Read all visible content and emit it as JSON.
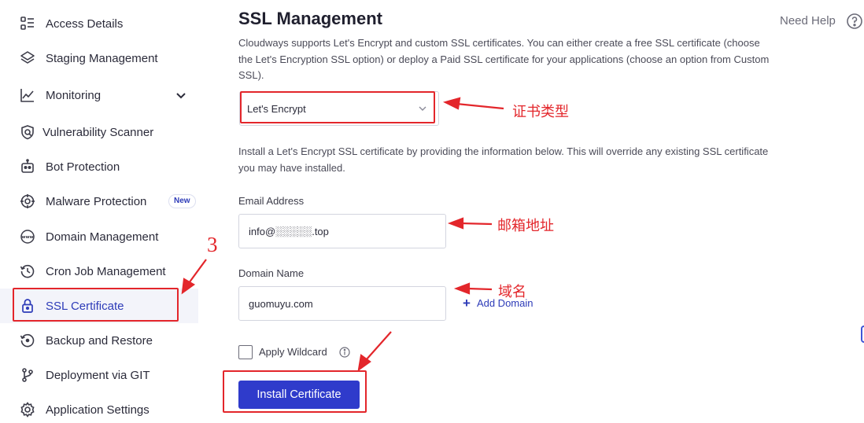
{
  "sidebar": {
    "items": [
      {
        "label": "Access Details",
        "icon": "access-details-icon"
      },
      {
        "label": "Staging Management",
        "icon": "layers-icon"
      },
      {
        "label": "Monitoring",
        "icon": "line-chart-icon"
      },
      {
        "label": "Vulnerability Scanner",
        "icon": "shield-scan-icon"
      },
      {
        "label": "Bot Protection",
        "icon": "robot-icon"
      },
      {
        "label": "Malware Protection",
        "icon": "target-icon",
        "badge": "New"
      },
      {
        "label": "Domain Management",
        "icon": "www-globe-icon"
      },
      {
        "label": "Cron Job Management",
        "icon": "history-clock-icon"
      },
      {
        "label": "SSL Certificate",
        "icon": "lock-icon",
        "active": true
      },
      {
        "label": "Backup and Restore",
        "icon": "restore-icon"
      },
      {
        "label": "Deployment via GIT",
        "icon": "git-branch-icon"
      },
      {
        "label": "Application Settings",
        "icon": "gear-icon"
      }
    ]
  },
  "main": {
    "title": "SSL Management",
    "need_help": "Need Help",
    "description": "Cloudways supports Let's Encrypt and custom SSL certificates. You can either create a free SSL certificate (choose the Let's Encryption SSL option) or deploy a Paid SSL certificate for your applications (choose an option from Custom SSL).",
    "ssl_type_selected": "Let's Encrypt",
    "install_description": "Install a Let's Encrypt SSL certificate by providing the information below. This will override any existing SSL certificate you may have installed.",
    "email_label": "Email Address",
    "email_value": "info@░░░░░.top",
    "domain_label": "Domain Name",
    "domain_value": "guomuyu.com",
    "add_domain": "Add Domain",
    "wildcard_label": "Apply Wildcard",
    "install_button": "Install Certificate"
  },
  "annotations": {
    "cert_type": "证书类型",
    "email": "邮箱地址",
    "domain": "域名",
    "step_number": "3"
  },
  "colors": {
    "accent": "#2f3bcb",
    "annotation_red": "#e3262b",
    "active_bg": "#f3f4fa"
  }
}
